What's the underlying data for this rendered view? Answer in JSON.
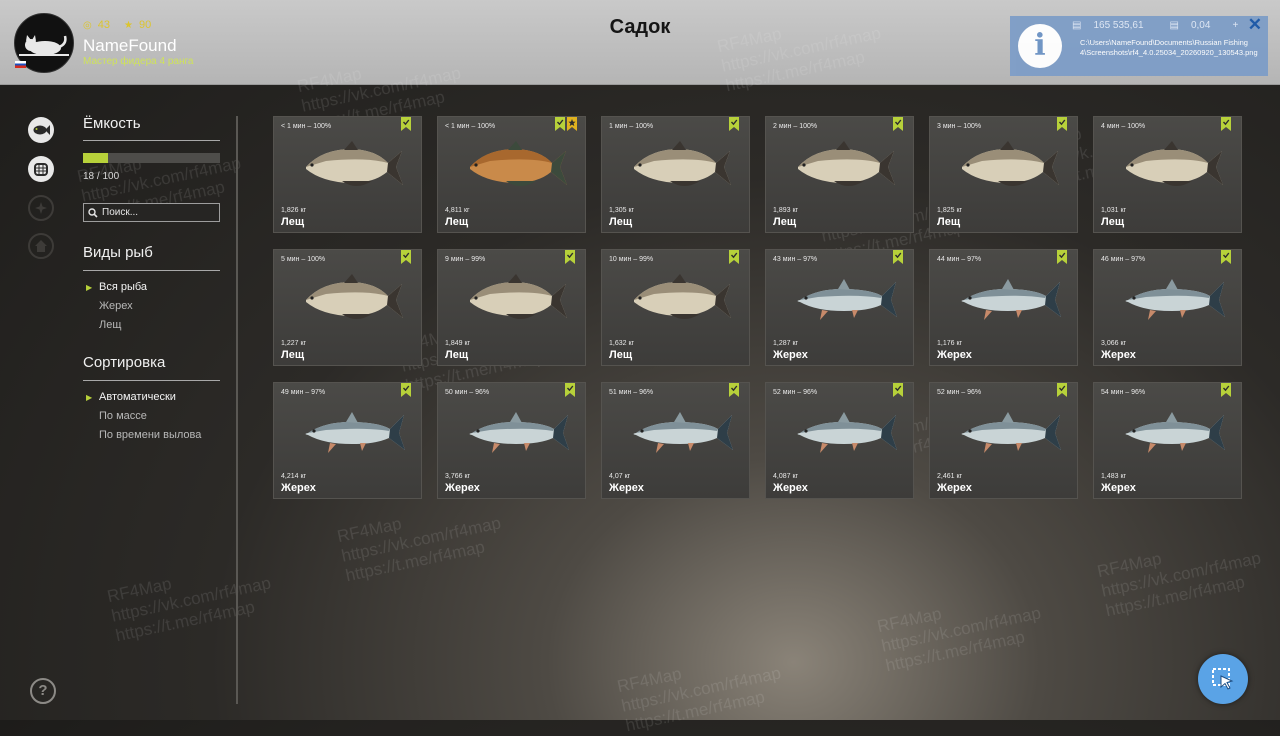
{
  "player": {
    "coins": "43",
    "stars": "90",
    "name": "NameFound",
    "rank": "Мастер фидера 4 ранга"
  },
  "title": "Садок",
  "notification": {
    "value_1": "165 535,61",
    "value_2": "0,04",
    "path": "C:\\Users\\NameFound\\Documents\\Russian Fishing 4\\Screenshots\\rf4_4.0.25034_20260920_130543.png"
  },
  "sidebar": {
    "capacity_title": "Ёмкость",
    "capacity_current": 18,
    "capacity_max": 100,
    "capacity_text": "18 / 100",
    "search_placeholder": "Поиск...",
    "species_title": "Виды рыб",
    "species": [
      "Вся рыба",
      "Жерех",
      "Лещ"
    ],
    "sort_title": "Сортировка",
    "sort_options": [
      "Автоматически",
      "По массе",
      "По времени вылова"
    ]
  },
  "fish": [
    {
      "time": "< 1 мин – 100%",
      "weight": "1,826 кг",
      "name": "Лещ",
      "kind": "bream",
      "trophy": false
    },
    {
      "time": "< 1 мин – 100%",
      "weight": "4,811 кг",
      "name": "Лещ",
      "kind": "bream-gold",
      "trophy": true
    },
    {
      "time": "1 мин – 100%",
      "weight": "1,305 кг",
      "name": "Лещ",
      "kind": "bream",
      "trophy": false
    },
    {
      "time": "2 мин – 100%",
      "weight": "1,893 кг",
      "name": "Лещ",
      "kind": "bream",
      "trophy": false
    },
    {
      "time": "3 мин – 100%",
      "weight": "1,825 кг",
      "name": "Лещ",
      "kind": "bream",
      "trophy": false
    },
    {
      "time": "4 мин – 100%",
      "weight": "1,031 кг",
      "name": "Лещ",
      "kind": "bream",
      "trophy": false
    },
    {
      "time": "5 мин – 100%",
      "weight": "1,227 кг",
      "name": "Лещ",
      "kind": "bream",
      "trophy": false
    },
    {
      "time": "9 мин – 99%",
      "weight": "1,849 кг",
      "name": "Лещ",
      "kind": "bream",
      "trophy": false
    },
    {
      "time": "10 мин – 99%",
      "weight": "1,632 кг",
      "name": "Лещ",
      "kind": "bream",
      "trophy": false
    },
    {
      "time": "43 мин – 97%",
      "weight": "1,287 кг",
      "name": "Жерех",
      "kind": "asp",
      "trophy": false
    },
    {
      "time": "44 мин – 97%",
      "weight": "1,176 кг",
      "name": "Жерех",
      "kind": "asp",
      "trophy": false
    },
    {
      "time": "46 мин – 97%",
      "weight": "3,066 кг",
      "name": "Жерех",
      "kind": "asp",
      "trophy": false
    },
    {
      "time": "49 мин – 97%",
      "weight": "4,214 кг",
      "name": "Жерех",
      "kind": "asp",
      "trophy": false
    },
    {
      "time": "50 мин – 96%",
      "weight": "3,766 кг",
      "name": "Жерех",
      "kind": "asp",
      "trophy": false
    },
    {
      "time": "51 мин – 96%",
      "weight": "4,07 кг",
      "name": "Жерех",
      "kind": "asp",
      "trophy": false
    },
    {
      "time": "52 мин – 96%",
      "weight": "4,087 кг",
      "name": "Жерех",
      "kind": "asp",
      "trophy": false
    },
    {
      "time": "52 мин – 96%",
      "weight": "2,461 кг",
      "name": "Жерех",
      "kind": "asp",
      "trophy": false
    },
    {
      "time": "54 мин – 96%",
      "weight": "1,483 кг",
      "name": "Жерех",
      "kind": "asp",
      "trophy": false
    }
  ],
  "watermarks": {
    "brand": "RF4Map",
    "vk": "https://vk.com/rf4map",
    "tg": "https://t.me/rf4map"
  },
  "colors": {
    "accent": "#b7d13a",
    "bookmark_gold": "#e0b21f",
    "notification": "#7f9ec7",
    "cursor_button": "#5aa3e6"
  },
  "icons": {
    "nav": [
      "fish-icon",
      "keepnet-icon",
      "compass-icon",
      "home-icon"
    ],
    "help": "help-icon",
    "cursor": "cursor-icon"
  }
}
